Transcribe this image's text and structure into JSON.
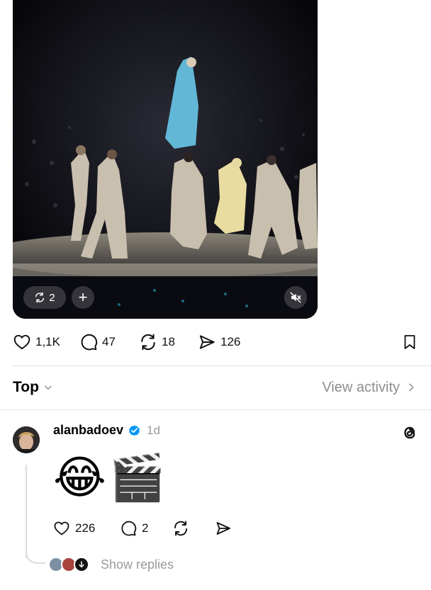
{
  "post": {
    "media": {
      "repost_count": "2",
      "add_label": "+"
    },
    "actions": {
      "likes": "1,1K",
      "replies": "47",
      "reposts": "18",
      "shares": "126"
    }
  },
  "sort": {
    "label": "Top",
    "view_activity": "View activity"
  },
  "comment": {
    "username": "alanbadoev",
    "timestamp": "1d",
    "emojis": "😂🎬",
    "likes": "226",
    "replies": "2",
    "show_replies": "Show replies"
  },
  "colors": {
    "verified": "#0095f6",
    "muted_text": "#9a9a9a"
  }
}
